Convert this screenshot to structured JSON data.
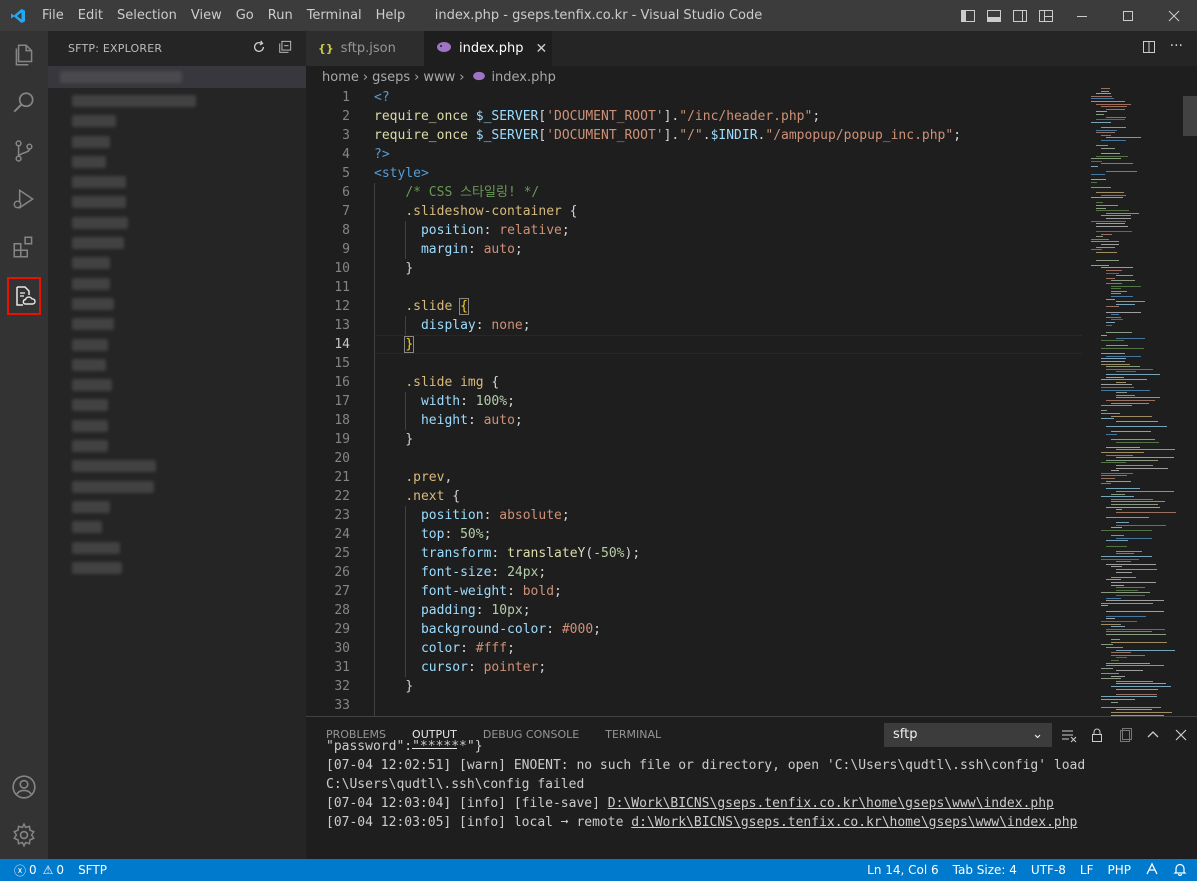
{
  "titlebar": {
    "menu": [
      "File",
      "Edit",
      "Selection",
      "View",
      "Go",
      "Run",
      "Terminal",
      "Help"
    ],
    "title": "index.php - gseps.tenfix.co.kr - Visual Studio Code"
  },
  "sidebar": {
    "title": "SFTP: EXPLORER"
  },
  "tabs": [
    {
      "label": "sftp.json",
      "icon": "{}"
    },
    {
      "label": "index.php",
      "icon": "php-icon"
    }
  ],
  "breadcrumb": [
    "home",
    "gseps",
    "www",
    "index.php"
  ],
  "editor": {
    "current_line": 14,
    "line_numbers": [
      "1",
      "2",
      "3",
      "4",
      "5",
      "6",
      "7",
      "8",
      "9",
      "10",
      "11",
      "12",
      "13",
      "14",
      "15",
      "16",
      "17",
      "18",
      "19",
      "20",
      "21",
      "22",
      "23",
      "24",
      "25",
      "26",
      "27",
      "28",
      "29",
      "30",
      "31",
      "32",
      "33"
    ],
    "code": {
      "l1": "<?",
      "l2a": "require_once ",
      "l2b": "$_SERVER",
      "l2c": "[",
      "l2d": "'DOCUMENT_ROOT'",
      "l2e": "].",
      "l2f": "\"/inc/header.php\"",
      "l2g": ";",
      "l3a": "require_once ",
      "l3b": "$_SERVER",
      "l3c": "[",
      "l3d": "'DOCUMENT_ROOT'",
      "l3e": "].",
      "l3f": "\"/\"",
      "l3g": ".",
      "l3h": "$INDIR",
      "l3i": ".",
      "l3j": "\"/ampopup/popup_inc.php\"",
      "l3k": ";",
      "l4": "?>",
      "l5": "<style>",
      "l6": "/* CSS 스타일링! */",
      "l7": ".slideshow-container",
      "l8p": "position",
      "l8v": "relative",
      "l9p": "margin",
      "l9v": "auto",
      "l12": ".slide",
      "l13p": "display",
      "l13v": "none",
      "l16": ".slide img",
      "l17p": "width",
      "l17v": "100%",
      "l18p": "height",
      "l18v": "auto",
      "l21": ".prev",
      "l22": ".next",
      "l23p": "position",
      "l23v": "absolute",
      "l24p": "top",
      "l24v": "50%",
      "l25p": "transform",
      "l25f": "translateY",
      "l25v": "-50%",
      "l26p": "font-size",
      "l26v": "24px",
      "l27p": "font-weight",
      "l27v": "bold",
      "l28p": "padding",
      "l28v": "10px",
      "l29p": "background-color",
      "l29v": "#000",
      "l30p": "color",
      "l30v": "#fff",
      "l31p": "cursor",
      "l31v": "pointer"
    }
  },
  "panel": {
    "tabs": [
      "PROBLEMS",
      "OUTPUT",
      "DEBUG CONSOLE",
      "TERMINAL"
    ],
    "active_tab": "OUTPUT",
    "channel": "sftp",
    "lines": {
      "l0": "\"password\":\"******\"}",
      "l1": "[07-04 12:02:51] [warn] ENOENT: no such file or directory, open 'C:\\Users\\qudtl\\.ssh\\config' load",
      "l2": "C:\\Users\\qudtl\\.ssh\\config failed",
      "l3a": "[07-04 12:03:04] [info] [file-save] ",
      "l3b": "D:\\Work\\BICNS\\gseps.tenfix.co.kr\\home\\gseps\\www\\index.php",
      "l4a": "[07-04 12:03:05] [info] local ➞ remote ",
      "l4b": "d:\\Work\\BICNS\\gseps.tenfix.co.kr\\home\\gseps\\www\\index.php"
    }
  },
  "statusbar": {
    "errors": "0",
    "warnings": "0",
    "sftp": "SFTP",
    "position": "Ln 14, Col 6",
    "tab_size": "Tab Size: 4",
    "encoding": "UTF-8",
    "eol": "LF",
    "language": "PHP"
  },
  "colors": {
    "accent": "#007acc",
    "highlight_box": "#e51400"
  }
}
